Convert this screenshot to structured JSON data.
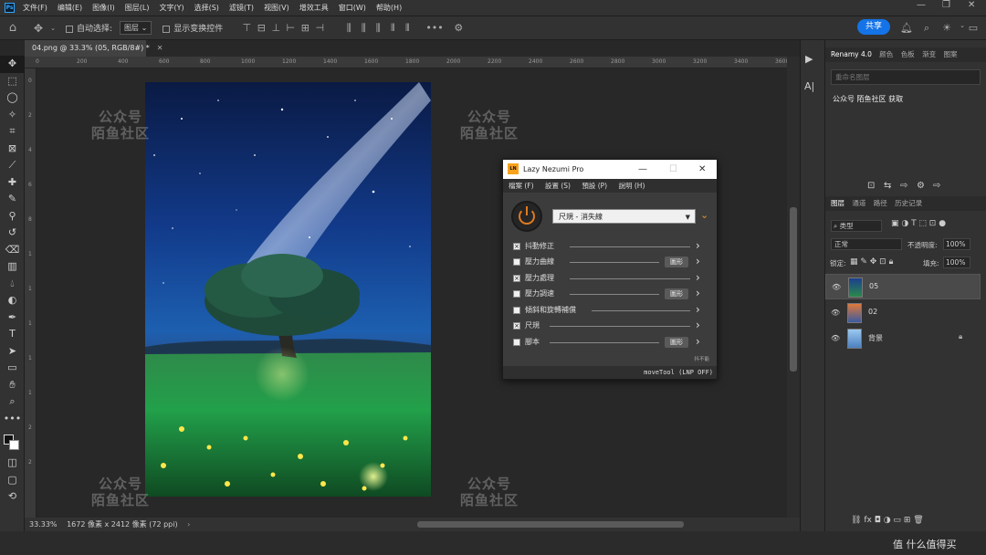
{
  "app": {
    "menu": [
      "文件(F)",
      "编辑(E)",
      "图像(I)",
      "图层(L)",
      "文字(Y)",
      "选择(S)",
      "滤镜(T)",
      "视图(V)",
      "增效工具",
      "窗口(W)",
      "帮助(H)"
    ]
  },
  "options_bar": {
    "auto_select_label": "自动选择:",
    "auto_select_value": "图层",
    "show_transform_label": "显示变换控件",
    "share_label": "共享"
  },
  "document": {
    "tab_title": "04.png @ 33.3% (05, RGB/8#) *",
    "zoom": "33.33%",
    "size_info": "1672 像素 x 2412 像素 (72 ppi)"
  },
  "rulers": {
    "h_ticks": [
      "0",
      "200",
      "400",
      "600",
      "800",
      "1000",
      "1200",
      "1400",
      "1600",
      "1800",
      "2000",
      "2200",
      "2400",
      "2600",
      "2800",
      "3000",
      "3200",
      "3400",
      "3600"
    ],
    "v_ticks": [
      "0",
      "2",
      "4",
      "6",
      "8",
      "1",
      "1",
      "1",
      "1",
      "1",
      "2",
      "2"
    ]
  },
  "watermark": {
    "line1": "公众号",
    "line2": "陌鱼社区"
  },
  "plugin": {
    "title": "Lazy Nezumi Pro",
    "logo_text": "LN",
    "menu": [
      "檔案 (F)",
      "設置 (S)",
      "預設 (P)",
      "說明 (H)"
    ],
    "preset": "尺規 - 消失線",
    "rows": [
      {
        "label": "抖動修正",
        "checked": true,
        "button": ""
      },
      {
        "label": "壓力曲線",
        "checked": false,
        "button": "圖形"
      },
      {
        "label": "壓力處理",
        "checked": true,
        "button": ""
      },
      {
        "label": "壓力調速",
        "checked": false,
        "button": "圖形"
      },
      {
        "label": "傾斜和旋轉補償",
        "checked": false,
        "button": ""
      },
      {
        "label": "尺規",
        "checked": true,
        "button": ""
      },
      {
        "label": "腳本",
        "checked": false,
        "button": "圖形"
      }
    ],
    "credit": "抖不能",
    "status": "moveTool (LNP OFF)"
  },
  "panels": {
    "top_tabs": [
      "Renamy 4.0",
      "颜色",
      "色板",
      "渐变",
      "图案"
    ],
    "search_placeholder": "重命名图层",
    "note": "公众号 陌鱼社区 获取",
    "layer_tabs": [
      "图层",
      "通道",
      "路径",
      "历史记录"
    ],
    "kind_label": "类型",
    "blend_mode": "正常",
    "opacity_label": "不透明度:",
    "opacity_value": "100%",
    "lock_label": "锁定:",
    "fill_label": "填充:",
    "fill_value": "100%",
    "layers": [
      {
        "name": "05",
        "selected": true,
        "locked": false
      },
      {
        "name": "02",
        "selected": false,
        "locked": false
      },
      {
        "name": "背景",
        "selected": false,
        "locked": true
      }
    ]
  },
  "footer_watermark": "值 什么值得买",
  "colors": {
    "accent": "#1473e6",
    "plugin_orange": "#e07a1f",
    "panel_bg": "#323232",
    "canvas_bg": "#282828"
  }
}
